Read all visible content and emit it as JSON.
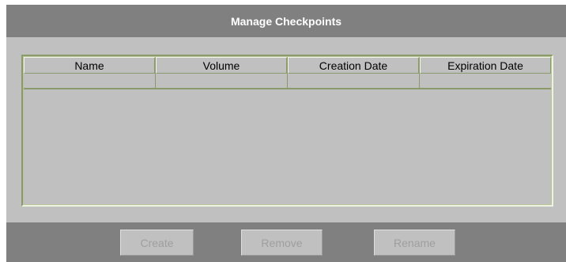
{
  "dialog": {
    "title": "Manage Checkpoints"
  },
  "table": {
    "columns": [
      "Name",
      "Volume",
      "Creation Date",
      "Expiration Date"
    ],
    "rows": []
  },
  "buttons": {
    "create_label": "Create",
    "remove_label": "Remove",
    "rename_label": "Rename"
  },
  "colors": {
    "title_bar": "#808080",
    "panel": "#c0c0c0",
    "disabled_text": "#9e9e9e"
  }
}
